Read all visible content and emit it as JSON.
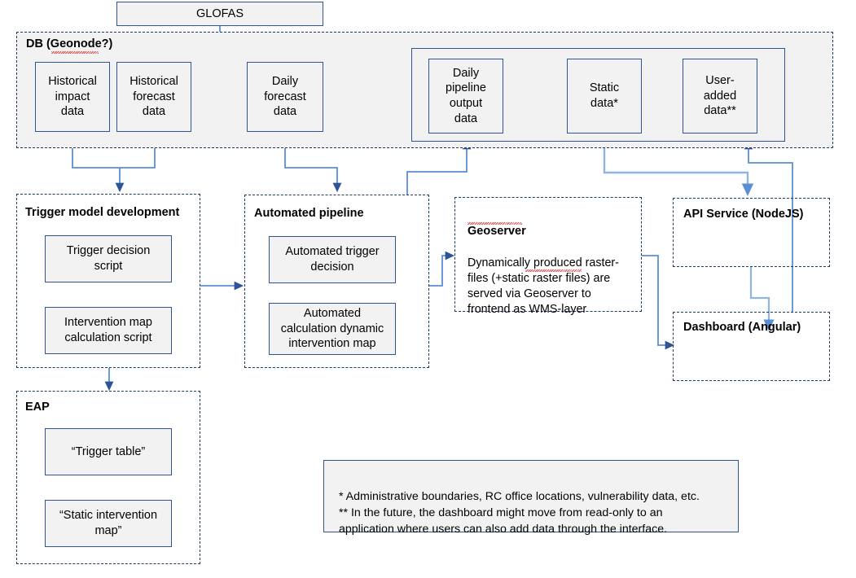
{
  "diagram": {
    "title": "GLOFAS data pipeline architecture",
    "colors": {
      "box_border": "#2E5496",
      "box_fill": "#F2F2F2",
      "group_border": "#1F3864",
      "group_fill": "#F2F2F2",
      "arrow": "#5B8FD4",
      "arrow_dark": "#2E5496",
      "spellcheck_underline": "#E03A3A"
    }
  },
  "source": {
    "glofas_label": "GLOFAS"
  },
  "db_group": {
    "label": "DB (Geonode?)",
    "boxes": [
      {
        "id": "historical-impact-data",
        "label": "Historical\nimpact\ndata"
      },
      {
        "id": "historical-forecast-data",
        "label": "Historical forecast\ndata"
      },
      {
        "id": "daily-forecast-data",
        "label": "Daily\nforecast\ndata"
      }
    ],
    "inner_group_boxes": [
      {
        "id": "daily-pipeline-output-data",
        "label": "Daily\npipeline\noutput\ndata"
      },
      {
        "id": "static-data",
        "label": "Static\ndata*"
      },
      {
        "id": "user-added-data",
        "label": "User-\nadded\ndata**"
      }
    ]
  },
  "trigger_model_development": {
    "label": "Trigger model development",
    "boxes": [
      {
        "id": "trigger-decision-script",
        "label": "Trigger decision\nscript"
      },
      {
        "id": "intervention-map-calculation-script",
        "label": "Intervention map\ncalculation script"
      }
    ]
  },
  "automated_pipeline": {
    "label": "Automated pipeline",
    "boxes": [
      {
        "id": "automated-trigger-decision",
        "label": "Automated trigger\ndecision"
      },
      {
        "id": "automated-calculation-dynamic-intervention-map",
        "label": "Automated\ncalculation dynamic\nintervention map"
      }
    ]
  },
  "eap": {
    "label": "EAP",
    "boxes": [
      {
        "id": "trigger-table",
        "label": "“Trigger table”"
      },
      {
        "id": "static-intervention-map",
        "label": "“Static intervention\nmap”"
      }
    ]
  },
  "geoserver": {
    "label": "Geoserver",
    "description": "Dynamically produced raster-\nfiles (+static raster files) are\nserved via Geoserver to\nfrontend as WMS-layer"
  },
  "api_service": {
    "label": "API Service (NodeJS)"
  },
  "dashboard": {
    "label": "Dashboard (Angular)"
  },
  "footnotes": {
    "text": "* Administrative boundaries, RC office locations, vulnerability data, etc.\n** In the future, the dashboard might move from read-only to an\napplication where users can also add data through the interface."
  },
  "chart_data": {
    "type": "diagram",
    "title": "GLOFAS data pipeline architecture",
    "nodes": [
      {
        "id": "glofas",
        "label": "GLOFAS",
        "group": null
      },
      {
        "id": "historical-impact-data",
        "label": "Historical impact data",
        "group": "DB (Geonode?)"
      },
      {
        "id": "historical-forecast-data",
        "label": "Historical forecast data",
        "group": "DB (Geonode?)"
      },
      {
        "id": "daily-forecast-data",
        "label": "Daily forecast data",
        "group": "DB (Geonode?)"
      },
      {
        "id": "daily-pipeline-output-data",
        "label": "Daily pipeline output data",
        "group": "DB (Geonode?)"
      },
      {
        "id": "static-data",
        "label": "Static data*",
        "group": "DB (Geonode?)"
      },
      {
        "id": "user-added-data",
        "label": "User-added data**",
        "group": "DB (Geonode?)"
      },
      {
        "id": "trigger-decision-script",
        "label": "Trigger decision script",
        "group": "Trigger model development"
      },
      {
        "id": "intervention-map-calculation-script",
        "label": "Intervention map calculation script",
        "group": "Trigger model development"
      },
      {
        "id": "automated-trigger-decision",
        "label": "Automated trigger decision",
        "group": "Automated pipeline"
      },
      {
        "id": "automated-calculation-dynamic-intervention-map",
        "label": "Automated calculation dynamic intervention map",
        "group": "Automated pipeline"
      },
      {
        "id": "trigger-table",
        "label": "“Trigger table”",
        "group": "EAP"
      },
      {
        "id": "static-intervention-map",
        "label": "“Static intervention map”",
        "group": "EAP"
      },
      {
        "id": "geoserver",
        "label": "Geoserver",
        "group": null
      },
      {
        "id": "api-service",
        "label": "API Service (NodeJS)",
        "group": null
      },
      {
        "id": "dashboard",
        "label": "Dashboard (Angular)",
        "group": null
      }
    ],
    "edges": [
      {
        "from": "glofas",
        "to": "historical-forecast-data"
      },
      {
        "from": "glofas",
        "to": "daily-forecast-data"
      },
      {
        "from": "historical-impact-data",
        "to": "trigger-model-development"
      },
      {
        "from": "historical-forecast-data",
        "to": "trigger-model-development"
      },
      {
        "from": "daily-forecast-data",
        "to": "automated-pipeline"
      },
      {
        "from": "trigger-model-development",
        "to": "automated-pipeline"
      },
      {
        "from": "trigger-model-development",
        "to": "eap"
      },
      {
        "from": "automated-pipeline",
        "to": "daily-pipeline-output-data"
      },
      {
        "from": "automated-pipeline",
        "to": "geoserver"
      },
      {
        "from": "static-data",
        "to": "api-service"
      },
      {
        "from": "daily-pipeline-output-data",
        "to": "api-service"
      },
      {
        "from": "geoserver",
        "to": "dashboard"
      },
      {
        "from": "api-service",
        "to": "dashboard"
      },
      {
        "from": "dashboard",
        "to": "user-added-data"
      }
    ]
  }
}
